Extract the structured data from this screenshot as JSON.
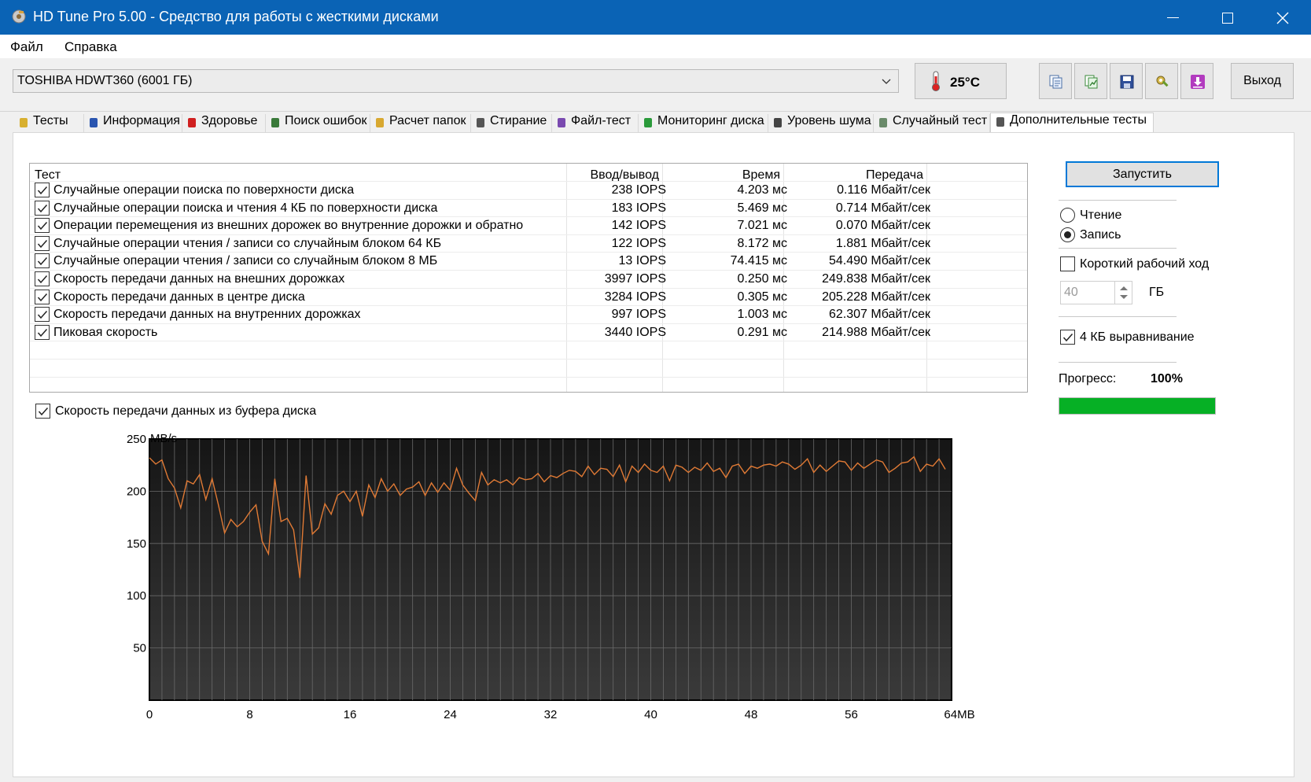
{
  "window": {
    "title": "HD Tune Pro 5.00 - Средство для работы с жесткими дисками"
  },
  "menu": {
    "file": "Файл",
    "help": "Справка"
  },
  "toolbar": {
    "drive": "TOSHIBA HDWT360 (6001 ГБ)",
    "temperature": "25°C",
    "exit": "Выход",
    "icons": [
      "copy-text-icon",
      "copy-screenshot-icon",
      "save-icon",
      "settings-icon",
      "download-icon"
    ]
  },
  "tabs": [
    {
      "label": "Тесты",
      "icon": "benchmark-icon"
    },
    {
      "label": "Информация",
      "icon": "info-icon"
    },
    {
      "label": "Здоровье",
      "icon": "health-icon"
    },
    {
      "label": "Поиск ошибок",
      "icon": "error-scan-icon"
    },
    {
      "label": "Расчет папок",
      "icon": "folder-icon"
    },
    {
      "label": "Стирание",
      "icon": "erase-icon"
    },
    {
      "label": "Файл-тест",
      "icon": "file-icon"
    },
    {
      "label": "Мониторинг диска",
      "icon": "monitor-icon"
    },
    {
      "label": "Уровень шума",
      "icon": "speaker-icon"
    },
    {
      "label": "Случайный тест",
      "icon": "random-test-icon"
    },
    {
      "label": "Дополнительные тесты",
      "icon": "extra-tests-icon",
      "active": true
    }
  ],
  "results": {
    "headers": {
      "test": "Тест",
      "io": "Ввод/вывод",
      "time": "Время",
      "transfer": "Передача"
    },
    "rows": [
      {
        "checked": true,
        "name": "Случайные операции поиска по поверхности диска",
        "io": "238 IOPS",
        "time": "4.203 мс",
        "transfer": "0.116 Мбайт/сек"
      },
      {
        "checked": true,
        "name": "Случайные операции поиска и чтения 4 КБ по поверхности диска",
        "io": "183 IOPS",
        "time": "5.469 мс",
        "transfer": "0.714 Мбайт/сек"
      },
      {
        "checked": true,
        "name": "Операции перемещения из внешних дорожек во внутренние дорожки и обратно",
        "io": "142 IOPS",
        "time": "7.021 мс",
        "transfer": "0.070 Мбайт/сек"
      },
      {
        "checked": true,
        "name": "Случайные операции чтения / записи со случайным блоком 64 КБ",
        "io": "122 IOPS",
        "time": "8.172 мс",
        "transfer": "1.881 Мбайт/сек"
      },
      {
        "checked": true,
        "name": "Случайные операции чтения / записи со случайным блоком 8 МБ",
        "io": "13 IOPS",
        "time": "74.415 мс",
        "transfer": "54.490 Мбайт/сек"
      },
      {
        "checked": true,
        "name": "Скорость передачи данных на внешних дорожках",
        "io": "3997 IOPS",
        "time": "0.250 мс",
        "transfer": "249.838 Мбайт/сек"
      },
      {
        "checked": true,
        "name": "Скорость передачи данных в центре диска",
        "io": "3284 IOPS",
        "time": "0.305 мс",
        "transfer": "205.228 Мбайт/сек"
      },
      {
        "checked": true,
        "name": "Скорость передачи данных на внутренних дорожках",
        "io": "997 IOPS",
        "time": "1.003 мс",
        "transfer": "62.307 Мбайт/сек"
      },
      {
        "checked": true,
        "name": "Пиковая скорость",
        "io": "3440 IOPS",
        "time": "0.291 мс",
        "transfer": "214.988 Мбайт/сек"
      }
    ]
  },
  "buffer": {
    "checked": true,
    "label": "Скорость передачи данных из буфера диска"
  },
  "controls": {
    "start": "Запустить",
    "read": "Чтение",
    "write": "Запись",
    "selected_mode": "write",
    "short_stroke": {
      "label": "Короткий рабочий ход",
      "checked": false
    },
    "short_stroke_value": "40",
    "short_stroke_unit": "ГБ",
    "align_4kb": {
      "label": "4 КБ выравнивание",
      "checked": true
    },
    "progress_label": "Прогресс:",
    "progress_text": "100%",
    "progress": 1.0,
    "progress_color": "#06b025"
  },
  "chart_data": {
    "type": "line",
    "ylabel": "MB/s",
    "xlabel": "",
    "ylim": [
      0,
      250
    ],
    "xlim": [
      0,
      64
    ],
    "yticks": [
      "50",
      "100",
      "150",
      "200",
      "250"
    ],
    "xticks": [
      "0",
      "8",
      "16",
      "24",
      "32",
      "40",
      "48",
      "56",
      "64MB"
    ],
    "grid": true,
    "background": "#202020",
    "line_color": "#e07a35",
    "x": [
      0,
      0.5,
      1,
      1.5,
      2,
      2.5,
      3,
      3.5,
      4,
      4.5,
      5,
      5.5,
      6,
      6.5,
      7,
      7.5,
      8,
      8.5,
      9,
      9.5,
      10,
      10.5,
      11,
      11.5,
      12,
      12.5,
      13,
      13.5,
      14,
      14.5,
      15,
      15.5,
      16,
      16.5,
      17,
      17.5,
      18,
      18.5,
      19,
      19.5,
      20,
      20.5,
      21,
      21.5,
      22,
      22.5,
      23,
      23.5,
      24,
      24.5,
      25,
      25.5,
      26,
      26.5,
      27,
      27.5,
      28,
      28.5,
      29,
      29.5,
      30,
      30.5,
      31,
      31.5,
      32,
      32.5,
      33,
      33.5,
      34,
      34.5,
      35,
      35.5,
      36,
      36.5,
      37,
      37.5,
      38,
      38.5,
      39,
      39.5,
      40,
      40.5,
      41,
      41.5,
      42,
      42.5,
      43,
      43.5,
      44,
      44.5,
      45,
      45.5,
      46,
      46.5,
      47,
      47.5,
      48,
      48.5,
      49,
      49.5,
      50,
      50.5,
      51,
      51.5,
      52,
      52.5,
      53,
      53.5,
      54,
      54.5,
      55,
      55.5,
      56,
      56.5,
      57,
      57.5,
      58,
      58.5,
      59,
      59.5,
      60,
      60.5,
      61,
      61.5,
      62,
      62.5,
      63,
      63.5
    ],
    "values": [
      232,
      226,
      230,
      212,
      203,
      184,
      210,
      207,
      216,
      192,
      212,
      187,
      160,
      173,
      166,
      171,
      180,
      187,
      152,
      140,
      212,
      171,
      174,
      163,
      117,
      215,
      159,
      165,
      188,
      178,
      196,
      200,
      190,
      200,
      176,
      206,
      194,
      212,
      200,
      207,
      196,
      202,
      204,
      209,
      196,
      208,
      199,
      208,
      201,
      222,
      206,
      198,
      191,
      218,
      206,
      211,
      208,
      211,
      206,
      213,
      211,
      212,
      217,
      209,
      215,
      213,
      217,
      220,
      219,
      214,
      224,
      216,
      222,
      221,
      214,
      225,
      209,
      224,
      218,
      226,
      220,
      218,
      224,
      210,
      225,
      223,
      218,
      223,
      220,
      227,
      219,
      222,
      213,
      224,
      226,
      217,
      224,
      222,
      225,
      226,
      224,
      228,
      226,
      221,
      225,
      231,
      218,
      225,
      219,
      224,
      229,
      228,
      220,
      227,
      222,
      226,
      230,
      228,
      218,
      222,
      227,
      228,
      233,
      219,
      226,
      224,
      231,
      221,
      226,
      218,
      225,
      230,
      228,
      224
    ],
    "__comment": ""
  }
}
